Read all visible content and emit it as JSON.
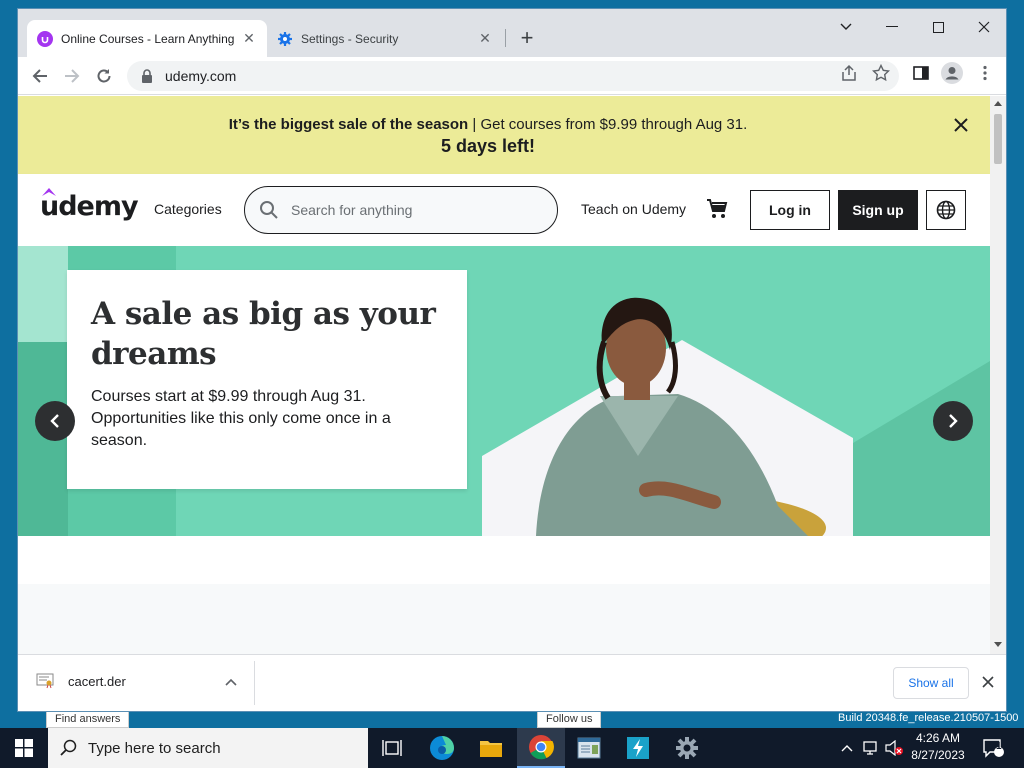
{
  "browser": {
    "tabs": [
      {
        "title": "Online Courses - Learn Anything",
        "active": true
      },
      {
        "title": "Settings - Security",
        "active": false
      }
    ],
    "url": "udemy.com"
  },
  "banner": {
    "bold": "It’s the biggest sale of the season",
    "rest": " | Get courses from $9.99 through Aug 31.",
    "countdown": "5 days left!"
  },
  "header": {
    "logo": "udemy",
    "categories": "Categories",
    "search_placeholder": "Search for anything",
    "teach": "Teach on Udemy",
    "login": "Log in",
    "signup": "Sign up"
  },
  "hero": {
    "title": "A sale as big as your dreams",
    "body": "Courses start at $9.99 through Aug 31. Opportunities like this only come once in a season."
  },
  "downloads": {
    "file": "cacert.der",
    "show_all": "Show all"
  },
  "desktop": {
    "peek_left": "Find answers",
    "peek_right": "Follow us",
    "build": "Build 20348.fe_release.210507-1500"
  },
  "taskbar": {
    "search_placeholder": "Type here to search",
    "time": "4:26 AM",
    "date": "8/27/2023",
    "notifications": "1"
  },
  "colors": {
    "banner": "#eceb98",
    "hero": "#6fd6b6",
    "udemy_purple": "#a435f0",
    "dark": "#1c1d1f"
  }
}
